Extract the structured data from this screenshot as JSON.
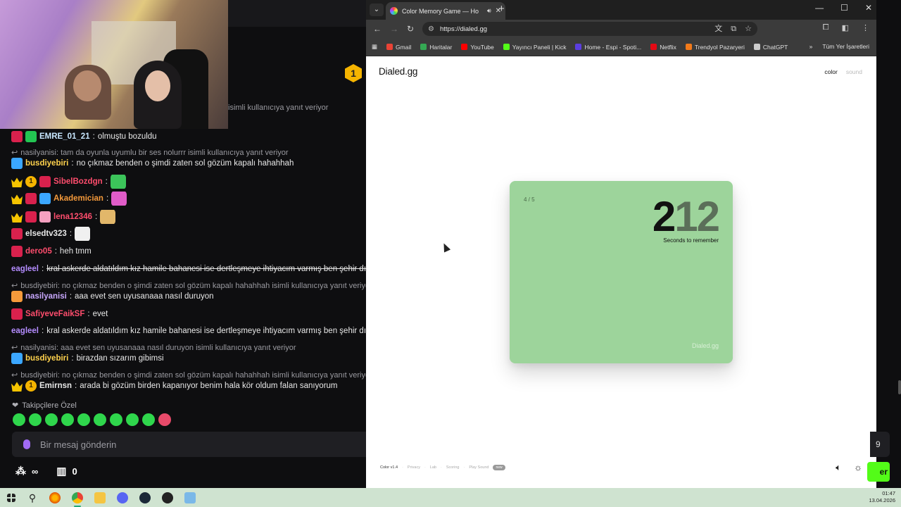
{
  "chat": {
    "pinned_badge": "1",
    "reply_top": "isimli kullanıcıya yanıt veriyor",
    "messages": [
      {
        "type": "msg",
        "user": "EMRE_01_21",
        "text": "olmuştu bozuldu",
        "color": "#c8e7ff",
        "badges": [
          "mod",
          "sub"
        ]
      },
      {
        "type": "reply",
        "text": "nasilyanisi: tam da oyunla uyumlu bir ses nolurrr isimli kullanıcıya yanıt veriyor"
      },
      {
        "type": "msg",
        "user": "busdiyebiri",
        "text": "no çıkmaz benden o şimdi zaten sol gözüm kapalı hahahhah",
        "color": "#ffd24d",
        "badges": [
          "gift"
        ]
      },
      {
        "type": "msg",
        "user": "SibelBozdgn",
        "text": "",
        "color": "#ff4d6d",
        "badges": [
          "crown",
          "coin",
          "mod"
        ],
        "emote": "#3cc45a"
      },
      {
        "type": "msg",
        "user": "Akademician",
        "text": "",
        "color": "#f59a3b",
        "badges": [
          "crown",
          "mod",
          "gift"
        ],
        "emote": "#e05cc8"
      },
      {
        "type": "msg",
        "user": "lena12346",
        "text": "",
        "color": "#ff4d6d",
        "badges": [
          "crown",
          "mod",
          "pink"
        ],
        "emote": "#e2b76a"
      },
      {
        "type": "msg",
        "user": "elsedtv323",
        "text": "",
        "color": "#e8e8e8",
        "badges": [
          "mod"
        ],
        "emote": "#f0f0f0"
      },
      {
        "type": "msg",
        "user": "dero05",
        "text": "heh tmm",
        "color": "#ff4d6d",
        "badges": [
          "mod"
        ]
      },
      {
        "type": "msg",
        "user": "eagleel",
        "text": "kral askerde aldatıldım kız hamile bahanesi ise dertleşmeye ihtiyacım varmış ben şehir dışı",
        "color": "#b48cff",
        "badges": [],
        "strike": true
      },
      {
        "type": "reply",
        "text": "busdiyebiri: no çıkmaz benden o şimdi zaten sol gözüm kapalı hahahhah isimli kullanıcıya yanıt veriyor"
      },
      {
        "type": "msg",
        "user": "nasilyanisi",
        "text": "aaa evet sen uyusanaaa nasıl duruyon",
        "color": "#c9a8ff",
        "badges": [
          "og"
        ]
      },
      {
        "type": "msg",
        "user": "SafiyeveFaikSF",
        "text": "evet",
        "color": "#ff4d6d",
        "badges": [
          "mod"
        ]
      },
      {
        "type": "msg",
        "user": "eagleel",
        "text": "kral askerde aldatıldım kız hamile bahanesi ise dertleşmeye ihtiyacım varmış ben şehir dışı",
        "color": "#b48cff",
        "badges": []
      },
      {
        "type": "reply",
        "text": "nasilyanisi: aaa evet sen uyusanaaa nasıl duruyon isimli kullanıcıya yanıt veriyor"
      },
      {
        "type": "msg",
        "user": "busdiyebiri",
        "text": "birazdan sızarım gibimsi",
        "color": "#ffd24d",
        "badges": [
          "gift"
        ]
      },
      {
        "type": "reply",
        "text": "busdiyebiri: no çıkmaz benden o şimdi zaten sol gözüm kapalı hahahhah isimli kullanıcıya yanıt veriyor"
      },
      {
        "type": "msg",
        "user": "Emirnsn",
        "text": "arada bi gözüm birden kapanıyor benim hala kör oldum falan sanıyorum",
        "color": "#e8e8e8",
        "badges": [
          "crown",
          "coin"
        ]
      }
    ],
    "followers_label": "Takipçilere Özel",
    "input_placeholder": "Bir mesaj gönderin",
    "infinity_label": "∞",
    "points_value": "0"
  },
  "browser": {
    "tab_title": "Color Memory Game — Ho",
    "url": "https://dialed.gg",
    "bookmarks": [
      {
        "label": "Gmail",
        "color": "#ea4335"
      },
      {
        "label": "Haritalar",
        "color": "#34a853"
      },
      {
        "label": "YouTube",
        "color": "#ff0000"
      },
      {
        "label": "Yayıncı Paneli | Kick",
        "color": "#53fc18"
      },
      {
        "label": "Home - Espi - Spoti...",
        "color": "#5b3ee0"
      },
      {
        "label": "Netflix",
        "color": "#e50914"
      },
      {
        "label": "Trendyol Pazaryeri",
        "color": "#f27a1a"
      },
      {
        "label": "ChatGPT",
        "color": "#cccccc"
      }
    ],
    "all_bookmarks": "Tüm Yer İşaretleri"
  },
  "page": {
    "logo": "Dialed.gg",
    "mode_color": "color",
    "mode_sound": "sound",
    "round": "4 / 5",
    "digit_first": "2",
    "digit_rest": "12",
    "seconds_label": "Seconds to remember",
    "card_brand": "Dialed.gg",
    "footer": {
      "version": "Color v1.4",
      "privacy": "Privacy",
      "lab": "Lab",
      "scoring": "Scoring",
      "play_sound": "Play Sound",
      "new_badge": "new"
    },
    "card_color": "#9dd49b"
  },
  "taskbar": {
    "time": "01:47",
    "date": "13.04.2026"
  },
  "underlying": {
    "button_text": "er",
    "dark_text": "9"
  }
}
